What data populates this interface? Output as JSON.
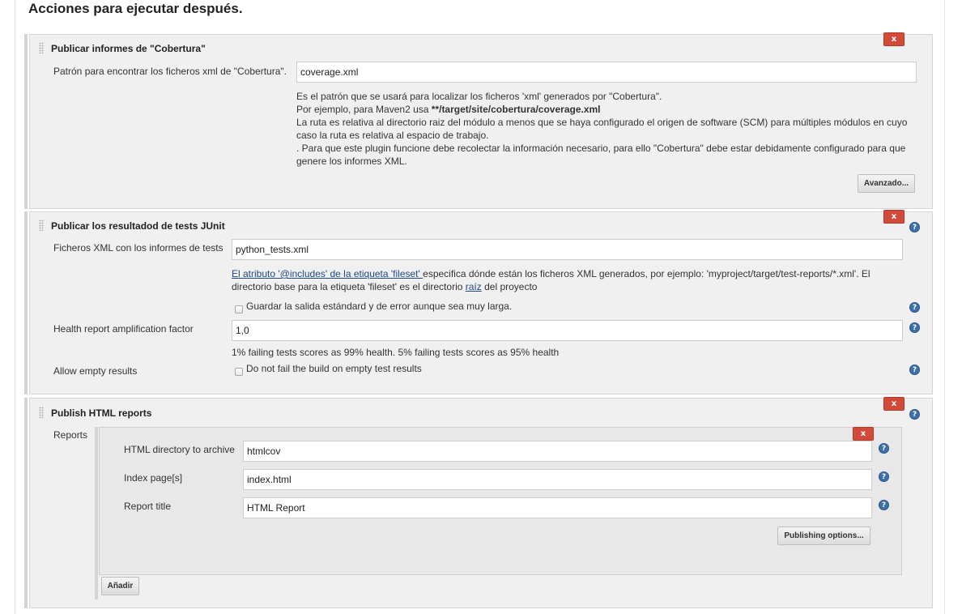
{
  "page": {
    "heading": "Acciones para ejecutar después."
  },
  "cobertura": {
    "title": "Publicar informes de \"Cobertura\"",
    "delete_label": "x",
    "pattern_label": "Patrón para encontrar los ficheros xml de \"Cobertura\".",
    "pattern_value": "coverage.xml",
    "help_line1": "Es el patrón que se usará para localizar los ficheros 'xml' generados por \"Cobertura\".",
    "help_line2_prefix": "Por ejemplo, para Maven2 usa ",
    "help_line2_bold": "**/target/site/cobertura/coverage.xml",
    "help_line3": "La ruta es relativa al directorio raiz del módulo a menos que se haya configurado el origen de software (SCM) para múltiples módulos en cuyo caso la ruta es relativa al espacio de trabajo.",
    "help_line4": ". Para que este plugin funcione debe recolectar la información necesario, para ello \"Cobertura\" debe estar debidamente configurado para que genere los informes XML.",
    "advanced_label": "Avanzado..."
  },
  "junit": {
    "title": "Publicar los resultadod de tests JUnit",
    "delete_label": "x",
    "files_label": "Ficheros XML con los informes de tests",
    "files_value": "python_tests.xml",
    "help_link": "El atributo '@includes' de la etiqueta 'fileset' ",
    "help_text1": "especifica dónde están los ficheros XML generados, por ejemplo: 'myproject/target/test-reports/*.xml'. El directorio base para la etiqueta 'fileset' es el directorio ",
    "help_link2": "raíz",
    "help_text2": " del proyecto",
    "keep_output_label": "Guardar la salida estándard y de error aunque sea muy larga.",
    "keep_output_checked": false,
    "amplification_label": "Health report amplification factor",
    "amplification_value": "1,0",
    "amplification_help": "1% failing tests scores as 99% health. 5% failing tests scores as 95% health",
    "allow_empty_label": "Allow empty results",
    "allow_empty_checkbox_label": "Do not fail the build on empty test results",
    "allow_empty_checked": false
  },
  "html_reports": {
    "title": "Publish HTML reports",
    "delete_label": "x",
    "reports_label": "Reports",
    "report_delete_label": "x",
    "dir_label": "HTML directory to archive",
    "dir_value": "htmlcov",
    "index_label": "Index page[s]",
    "index_value": "index.html",
    "title_label": "Report title",
    "title_value": "HTML Report",
    "publishing_options_label": "Publishing options...",
    "add_label": "Añadir"
  },
  "icons": {
    "help": "help-icon",
    "drag": "drag-handle-icon",
    "delete": "delete-icon"
  },
  "colors": {
    "delete_button": "#d24a3a",
    "help_icon": "#3d6fa8",
    "section_bg": "#f0f0f0"
  }
}
